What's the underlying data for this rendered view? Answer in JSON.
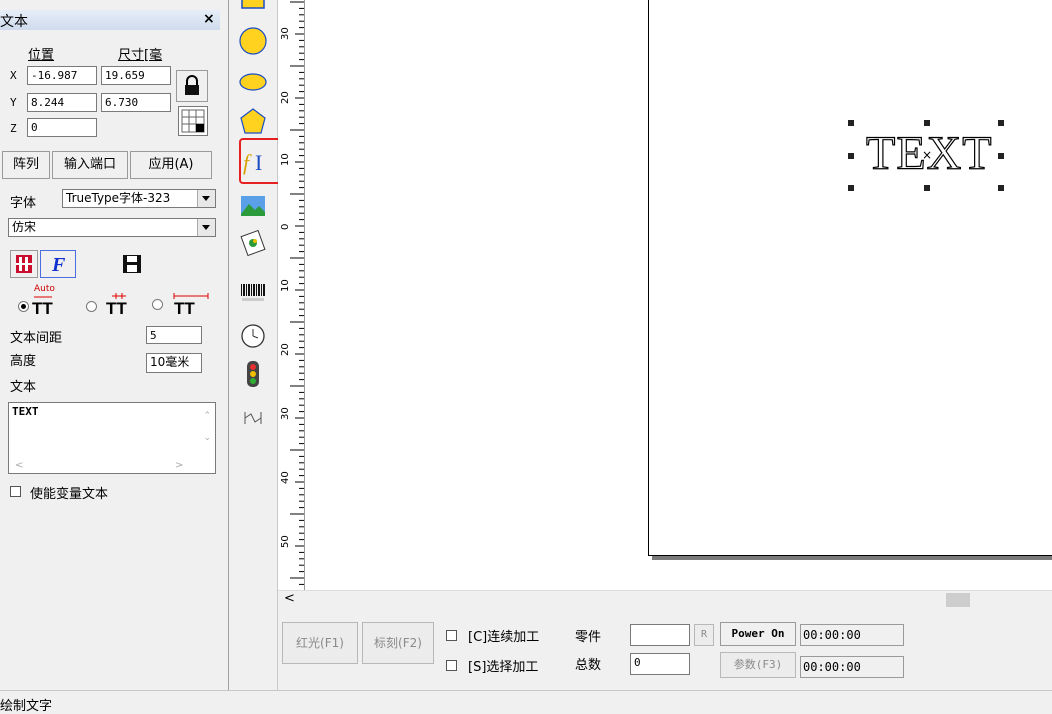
{
  "panel": {
    "title": "文本",
    "close_label": "×",
    "position_header": "位置",
    "size_header": "尺寸[毫",
    "x_label": "X",
    "y_label": "Y",
    "z_label": "Z",
    "x_position": "-16.987",
    "y_position": "8.244",
    "z_position": "0",
    "x_size": "19.659",
    "y_size": "6.730",
    "array_button": "阵列",
    "input_port_button": "输入端口",
    "apply_button": "应用(A)",
    "font_label": "字体",
    "font_type": "TrueType字体-323",
    "font_name": "仿宋",
    "radio_auto_label": "Auto",
    "text_spacing_label": "文本间距",
    "text_spacing_value": "5",
    "height_label": "高度",
    "height_value": "10毫米",
    "text_label": "文本",
    "text_value": "TEXT",
    "enable_variable_text": "使能变量文本"
  },
  "canvas": {
    "text_object": "TEXT",
    "ruler_labels": [
      "30",
      "20",
      "10",
      "0",
      "10",
      "20",
      "30",
      "40",
      "50"
    ]
  },
  "bottom": {
    "red_light_button": "红光(F1)",
    "mark_button": "标刻(F2)",
    "continuous_label": "[C]连续加工",
    "select_label": "[S]选择加工",
    "parts_label": "零件",
    "parts_value": "",
    "total_label": "总数",
    "total_value": "0",
    "reset_button": "R",
    "power_button": "Power On",
    "params_button": "参数(F3)",
    "time_1": "00:00:00",
    "time_2": "00:00:00"
  },
  "status": {
    "text": "绘制文字"
  }
}
